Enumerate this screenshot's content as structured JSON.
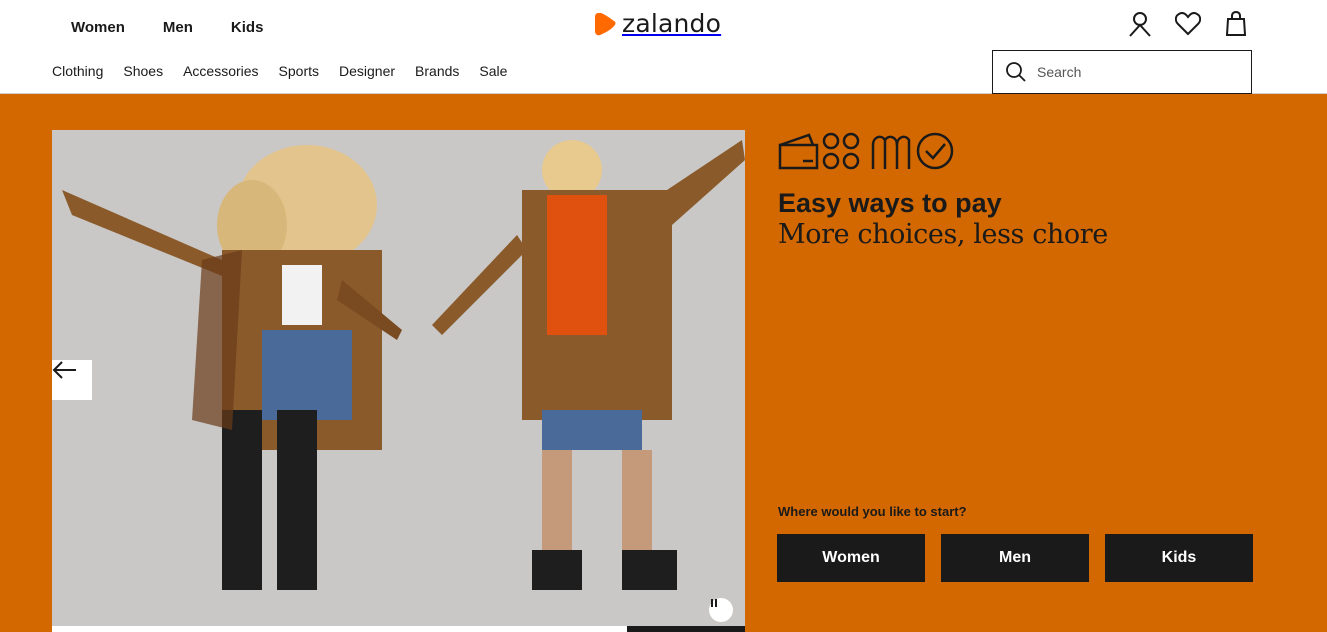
{
  "header": {
    "gender_nav": [
      "Women",
      "Men",
      "Kids"
    ],
    "logo_text": "zalando",
    "category_nav": [
      "Clothing",
      "Shoes",
      "Accessories",
      "Sports",
      "Designer",
      "Brands",
      "Sale"
    ],
    "search_placeholder": "Search",
    "icons": [
      "user-icon",
      "heart-icon",
      "bag-icon"
    ]
  },
  "hero": {
    "background_color": "#d46800",
    "pay_icons": [
      "wallet-icon",
      "installments-icon",
      "loops-icon",
      "check-circle-icon"
    ],
    "title": "Easy ways to pay",
    "subtitle": "More choices, less chore",
    "start_label": "Where would you like to start?",
    "start_buttons": [
      "Women",
      "Men",
      "Kids"
    ],
    "carousel_progress": 0.17
  },
  "colors": {
    "brand_orange": "#ff6900",
    "hero_orange": "#d46800",
    "dark": "#1a1a1a"
  }
}
